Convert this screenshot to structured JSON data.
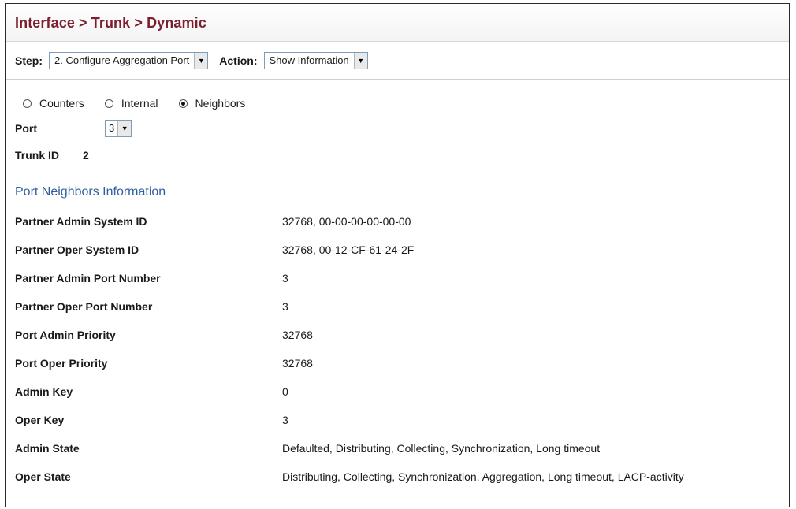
{
  "header": {
    "title": "Interface > Trunk > Dynamic"
  },
  "toolbar": {
    "step_label": "Step:",
    "step_value": "2. Configure Aggregation Port",
    "action_label": "Action:",
    "action_value": "Show Information"
  },
  "radios": [
    {
      "label": "Counters",
      "selected": false
    },
    {
      "label": "Internal",
      "selected": false
    },
    {
      "label": "Neighbors",
      "selected": true
    }
  ],
  "port": {
    "label": "Port",
    "value": "3"
  },
  "trunk": {
    "label": "Trunk ID",
    "value": "2"
  },
  "section": {
    "title": "Port Neighbors Information"
  },
  "rows": [
    {
      "label": "Partner Admin System ID",
      "value": "32768, 00-00-00-00-00-00"
    },
    {
      "label": "Partner Oper System ID",
      "value": "32768, 00-12-CF-61-24-2F"
    },
    {
      "label": "Partner Admin Port Number",
      "value": "3"
    },
    {
      "label": "Partner Oper Port Number",
      "value": "3"
    },
    {
      "label": "Port Admin Priority",
      "value": "32768"
    },
    {
      "label": "Port Oper Priority",
      "value": "32768"
    },
    {
      "label": "Admin Key",
      "value": "0"
    },
    {
      "label": "Oper Key",
      "value": "3"
    },
    {
      "label": "Admin State",
      "value": "Defaulted, Distributing, Collecting, Synchronization, Long timeout"
    },
    {
      "label": "Oper State",
      "value": "Distributing, Collecting, Synchronization, Aggregation, Long timeout, LACP-activity"
    }
  ]
}
